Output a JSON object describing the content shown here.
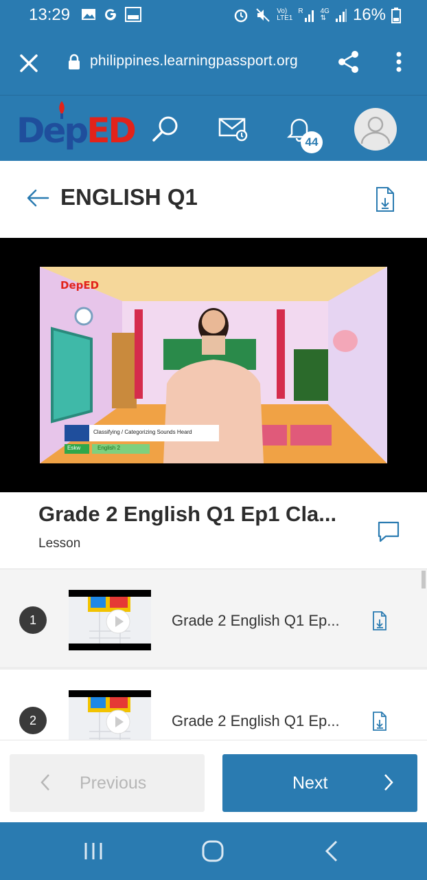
{
  "status_bar": {
    "time": "13:29",
    "signal_label_top": "Vo)",
    "signal_label_bottom": "LTE1",
    "r_label": "R",
    "net_label_top": "4G",
    "battery": "16%"
  },
  "browser": {
    "url": "philippines.learningpassport.org"
  },
  "header": {
    "logo_text_a": "Dep",
    "logo_text_b": "ED",
    "notification_count": "44"
  },
  "course": {
    "title": "ENGLISH Q1"
  },
  "video": {
    "logo": "DepED",
    "caption": "Classifying / Categorizing Sounds Heard",
    "tag_a": "Eskw",
    "tag_b": "English 2"
  },
  "lesson": {
    "title": "Grade 2 English Q1 Ep1 Cla...",
    "type": "Lesson"
  },
  "items": [
    {
      "number": "1",
      "title": "Grade 2 English Q1 Ep..."
    },
    {
      "number": "2",
      "title": "Grade 2 English Q1 Ep..."
    }
  ],
  "nav": {
    "previous": "Previous",
    "next": "Next"
  },
  "colors": {
    "primary": "#2a7bb1",
    "logo_blue": "#1f4e9c",
    "logo_red": "#e2231a"
  }
}
